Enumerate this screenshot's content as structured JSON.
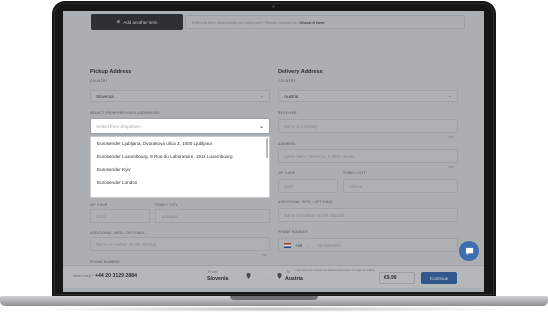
{
  "top": {
    "add_item_label": "Add another item",
    "add_item_icon": "plus-icon",
    "info_text": "Different item dimensions per shipment? Please contact us!",
    "info_link": "Check it here"
  },
  "pickup": {
    "title": "Pickup Address",
    "country_label": "COUNTRY",
    "country_value": "Slovenia",
    "previous_label": "SELECT FROM PREVIOUS ADDRESSES",
    "previous_placeholder": "Select from dropdown",
    "options": [
      "Eurosender Ljubljana, Dvorakova ulica 3, 1000 Ljubljana",
      "Eurosender Luxembourg, 9 Rue du Laboratoire, 1911 Luxembourg",
      "Eurosender Kyiv",
      "Eurosender London"
    ],
    "zip_label": "ZIP CODE",
    "zip_value": "1000",
    "city_label": "TOWN / CITY",
    "city_value": "Ljubljana",
    "additional_label": "ADDITIONAL INFO - OPTIONAL",
    "additional_placeholder": "Name or number on the doorbell",
    "phone_label": "PHONE NUMBER",
    "counter": "0/35"
  },
  "delivery": {
    "title": "Delivery Address",
    "country_label": "COUNTRY",
    "country_value": "Austria",
    "receiver_label": "RECEIVER",
    "receiver_placeholder": "Name & company",
    "address_label": "ADDRESS",
    "address_placeholder": "Street name, street no. & other details",
    "zip_label": "ZIP CODE",
    "zip_placeholder": "1020",
    "city_label": "TOWN / CITY",
    "city_placeholder": "Vienna",
    "additional_label": "ADDITIONAL INFO - OPTIONAL",
    "additional_placeholder": "Name or number on the doorbell",
    "phone_label": "PHONE NUMBER",
    "phone_code": "+44",
    "phone_placeholder": "2079460000",
    "counter_1": "0/35",
    "counter_2": "0/35"
  },
  "footer": {
    "need_help": "Need help?",
    "phone": "+44 20 3129 2884",
    "from_label": "From",
    "from_value": "Slovenia",
    "to_label": "To",
    "to_value": "Austria",
    "price": "€9.99",
    "continue_label": "Continue",
    "notice": "If the shipment exceeds the declared dimensions or weight an additional fee may apply."
  },
  "colors": {
    "accent": "#2f5f9e",
    "dark_button": "#2b2e31",
    "chat": "#3d6fb0"
  }
}
